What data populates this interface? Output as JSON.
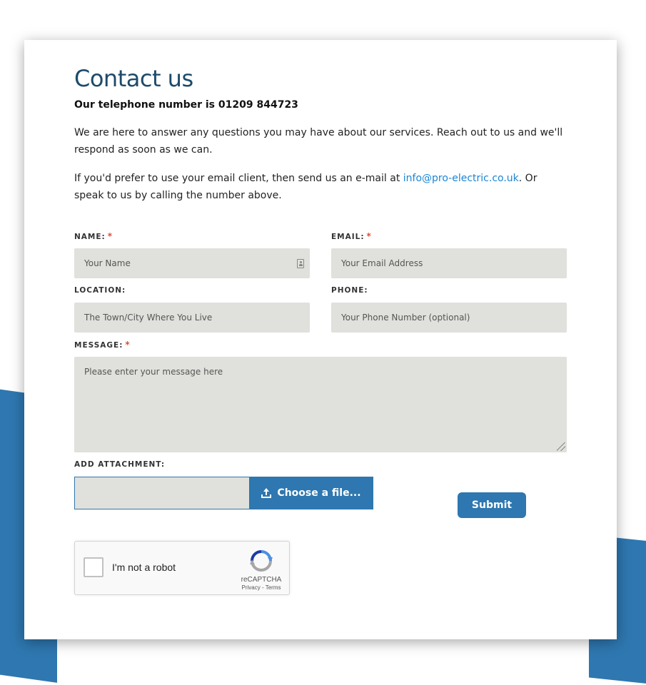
{
  "colors": {
    "title": "#1d4a6b",
    "accent_blue": "#2e77b0",
    "link": "#1a85d6",
    "required": "#e04a3a",
    "input_bg": "#e0e0dc"
  },
  "page": {
    "title": "Contact us",
    "phone_line": "Our telephone number is 01209 844723",
    "intro": "We are here to answer any questions you may have about our services. Reach out to us and we'll respond as soon as we can.",
    "email_pre": "If you'd prefer to use your email client, then send us an e-mail at ",
    "email": "info@pro-electric.co.uk",
    "email_post": ". Or speak to us by calling the number above."
  },
  "form": {
    "name": {
      "label": "NAME:",
      "required": "*",
      "placeholder": "Your Name"
    },
    "email": {
      "label": "EMAIL:",
      "required": "*",
      "placeholder": "Your Email Address"
    },
    "location": {
      "label": "LOCATION:",
      "placeholder": "The Town/City Where You Live"
    },
    "phone": {
      "label": "PHONE:",
      "placeholder": "Your Phone Number (optional)"
    },
    "message": {
      "label": "MESSAGE:",
      "required": "*",
      "placeholder": "Please enter your message here"
    },
    "attachment": {
      "label": "ADD ATTACHMENT:",
      "button_label": "Choose a file..."
    },
    "submit_label": "Submit"
  },
  "recaptcha": {
    "label": "I'm not a robot",
    "brand": "reCAPTCHA",
    "links": "Privacy - Terms"
  }
}
